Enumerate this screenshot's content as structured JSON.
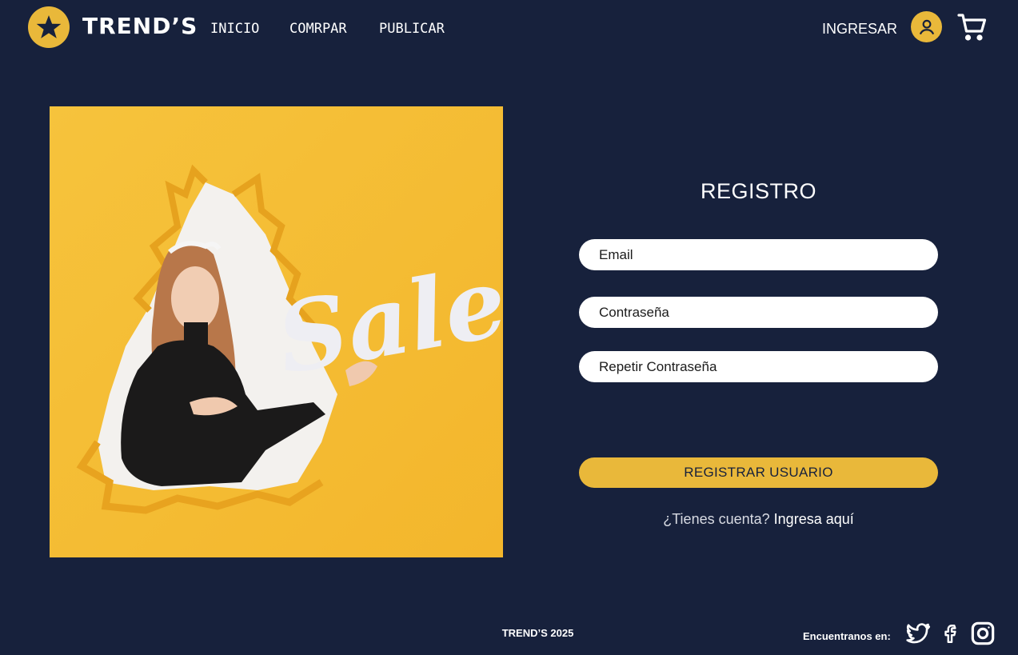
{
  "brand": {
    "name": "TREND’S",
    "accent": "#e9b83a",
    "background": "#17213c"
  },
  "nav": {
    "items": [
      {
        "label": "INICIO"
      },
      {
        "label": "COMRPAR"
      },
      {
        "label": "PUBLICAR"
      }
    ],
    "login_label": "INGRESAR",
    "icons": [
      "user-icon",
      "cart-icon"
    ]
  },
  "hero": {
    "text": "Sale"
  },
  "form": {
    "title": "REGISTRO",
    "email_placeholder": "Email",
    "password_placeholder": "Contraseña",
    "repeat_password_placeholder": "Repetir Contraseña",
    "submit_label": "REGISTRAR USUARIO",
    "account_question": "¿Tienes cuenta?",
    "account_link": "Ingresa aquí"
  },
  "footer": {
    "copyright": "TREND’S 2025",
    "find_us": "Encuentranos en:",
    "social_icons": [
      "twitter-icon",
      "facebook-icon",
      "instagram-icon"
    ]
  }
}
